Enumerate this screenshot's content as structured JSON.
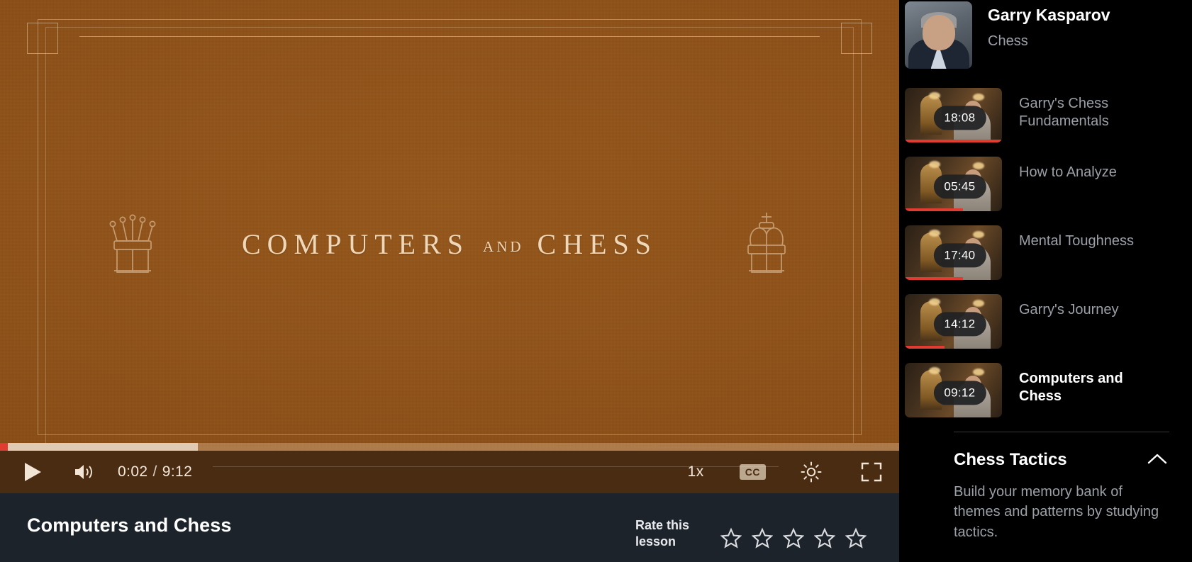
{
  "player": {
    "title_card": {
      "line": "COMPUTERS",
      "conjunction": "AND",
      "line2": "CHESS"
    },
    "controls": {
      "play_label": "Play",
      "volume_label": "Volume",
      "current_time": "0:02",
      "separator": "/",
      "duration": "9:12",
      "speed": "1x",
      "captions": "CC",
      "settings_label": "Settings",
      "fullscreen_label": "Fullscreen"
    },
    "progress": {
      "played_percent": 0.9,
      "buffered_percent": 22
    }
  },
  "meta": {
    "video_title": "Computers and Chess",
    "rate_label": "Rate this lesson",
    "stars": [
      1,
      2,
      3,
      4,
      5
    ]
  },
  "sidebar": {
    "instructor": {
      "name": "Garry Kasparov",
      "subject": "Chess"
    },
    "lessons": [
      {
        "title": "Garry's Chess Fundamentals",
        "duration": "18:08",
        "progress_percent": 100,
        "current": false
      },
      {
        "title": "How to Analyze",
        "duration": "05:45",
        "progress_percent": 60,
        "current": false
      },
      {
        "title": "Mental Toughness",
        "duration": "17:40",
        "progress_percent": 60,
        "current": false
      },
      {
        "title": "Garry's Journey",
        "duration": "14:12",
        "progress_percent": 41,
        "current": false
      },
      {
        "title": "Computers and Chess",
        "duration": "09:12",
        "progress_percent": 0,
        "current": true
      }
    ],
    "section": {
      "title": "Chess Tactics",
      "description": "Build your memory bank of themes and patterns by studying tactics.",
      "collapse_icon": "chevron-up-icon"
    }
  },
  "colors": {
    "accent_red": "#e03c31",
    "video_bg": "#8a4f18",
    "controls_bg": "#4a2c12",
    "meta_bg": "#1d232b",
    "sidebar_bg": "#000000"
  }
}
